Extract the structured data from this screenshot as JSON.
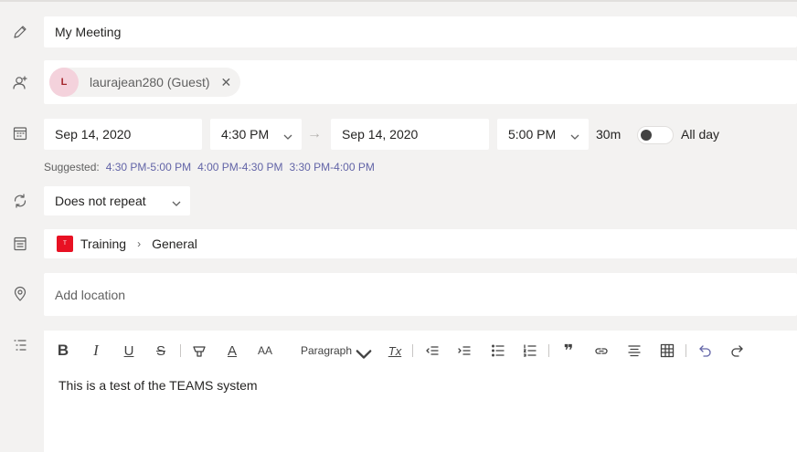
{
  "title": {
    "value": "My Meeting"
  },
  "attendees": [
    {
      "initial": "L",
      "name": "laurajean280 (Guest)",
      "remove": "✕"
    }
  ],
  "schedule": {
    "start_date": "Sep 14, 2020",
    "start_time": "4:30 PM",
    "arrow": "→",
    "end_date": "Sep 14, 2020",
    "end_time": "5:00 PM",
    "duration": "30m",
    "all_day_label": "All day",
    "all_day": false
  },
  "suggested": {
    "label": "Suggested:",
    "slots": [
      "4:30 PM-5:00 PM",
      "4:00 PM-4:30 PM",
      "3:30 PM-4:00 PM"
    ]
  },
  "repeat": {
    "value": "Does not repeat"
  },
  "channel": {
    "badge": "T",
    "team": "Training",
    "separator": "›",
    "channel": "General",
    "badge_color": "#e81123"
  },
  "location": {
    "placeholder": "Add location"
  },
  "editor": {
    "toolbar": {
      "bold": "B",
      "italic": "I",
      "underline": "U",
      "strike": "S",
      "font_color": "A",
      "font_size": "AA",
      "paragraph": "Paragraph",
      "clear_format": "Tx",
      "quote": "❞"
    },
    "body": "This is a test of the TEAMS system"
  },
  "colors": {
    "accent": "#6264a7",
    "background": "#f3f2f1",
    "avatar_bg": "#f4d2dc"
  }
}
